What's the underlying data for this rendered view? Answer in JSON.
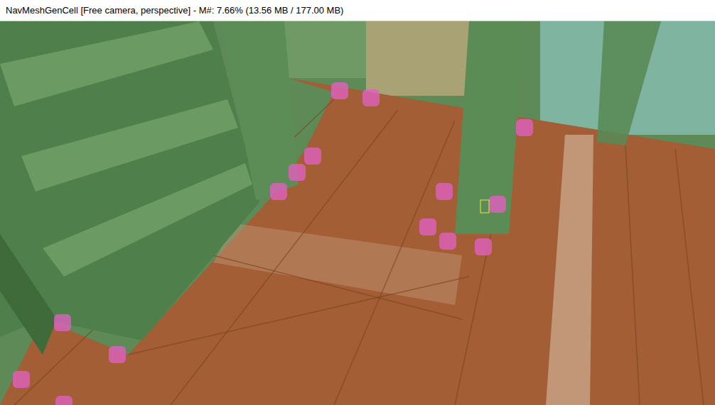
{
  "window": {
    "title": "NavMeshGenCell [Free camera, perspective] - M#: 7.66% (13.56 MB / 177.00 MB)"
  }
}
